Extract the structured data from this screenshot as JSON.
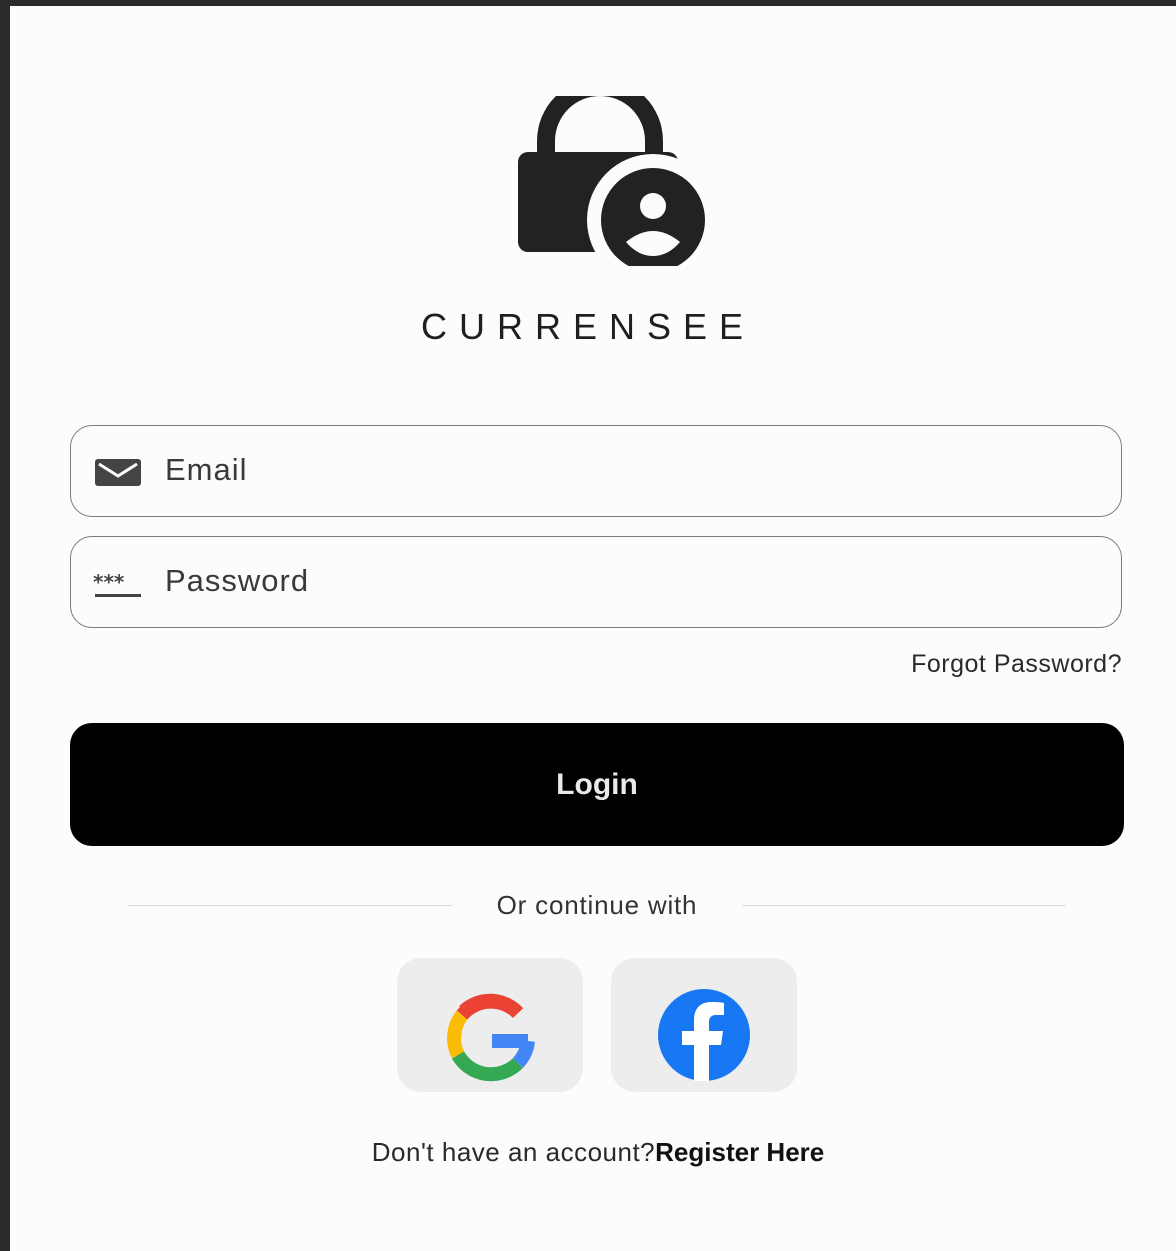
{
  "app": {
    "brand": "CURRENSEE"
  },
  "form": {
    "email_placeholder": "Email",
    "password_placeholder": "Password",
    "forgot_password": "Forgot Password?",
    "login_label": "Login"
  },
  "social": {
    "divider_text": "Or continue with",
    "google_icon": "google-icon",
    "facebook_icon": "facebook-icon"
  },
  "footer": {
    "prompt": "Don't have an account?",
    "register_link": "Register Here"
  },
  "colors": {
    "background": "#fdfbfc",
    "button": "#000000",
    "button_text": "#e9e9e9",
    "social_bg": "#ededed",
    "facebook_blue": "#1877f2"
  }
}
